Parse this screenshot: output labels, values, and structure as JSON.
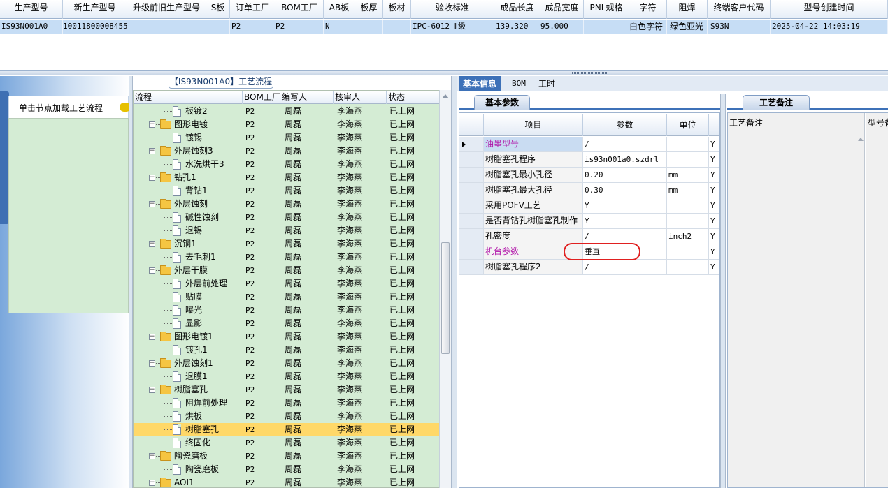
{
  "top_grid": {
    "headers": [
      {
        "label": "生产型号"
      },
      {
        "label": "新生产型号"
      },
      {
        "label": "升级前旧生产型号"
      },
      {
        "label": "S板"
      },
      {
        "label": "订单工厂"
      },
      {
        "label": "BOM工厂"
      },
      {
        "label": "AB板"
      },
      {
        "label": "板厚"
      },
      {
        "label": "板材"
      },
      {
        "label": "验收标准"
      },
      {
        "label": "成品长度"
      },
      {
        "label": "成品宽度"
      },
      {
        "label": "PNL规格"
      },
      {
        "label": "字符"
      },
      {
        "label": "阻焊"
      },
      {
        "label": "终端客户代码"
      },
      {
        "label": "型号创建时间"
      }
    ],
    "row": {
      "prod_model": "IS93N001A0",
      "new_model": "10011800008455",
      "old_model": "",
      "s_board": "",
      "order_factory": "P2",
      "bom_factory": "P2",
      "ab_board": "N",
      "thickness": "",
      "material": "",
      "standard": "IPC-6012 Ⅱ级",
      "length": "139.320",
      "width": "95.000",
      "pnl": "",
      "char": "白色字符",
      "solder": "绿色亚光",
      "client_code": "S93N",
      "created": "2025-04-22 14:03:19"
    }
  },
  "left": {
    "tab_label": "单击节点加载工艺流程"
  },
  "flow": {
    "caption": "【IS93N001A0】工艺流程",
    "headers": {
      "name": "流程",
      "bom": "BOM工厂",
      "writer": "编写人",
      "checker": "核审人",
      "status": "状态"
    },
    "rows": [
      {
        "name": "板镀2",
        "kind": "doc",
        "bom": "P2",
        "writer": "周磊",
        "checker": "李海燕",
        "status": "已上网"
      },
      {
        "name": "图形电镀",
        "kind": "folder",
        "bom": "P2",
        "writer": "周磊",
        "checker": "李海燕",
        "status": "已上网"
      },
      {
        "name": "镀锡",
        "kind": "doc",
        "bom": "P2",
        "writer": "周磊",
        "checker": "李海燕",
        "status": "已上网"
      },
      {
        "name": "外层蚀刻3",
        "kind": "folder",
        "bom": "P2",
        "writer": "周磊",
        "checker": "李海燕",
        "status": "已上网"
      },
      {
        "name": "水洗烘干3",
        "kind": "doc",
        "bom": "P2",
        "writer": "周磊",
        "checker": "李海燕",
        "status": "已上网"
      },
      {
        "name": "钻孔1",
        "kind": "folder",
        "bom": "P2",
        "writer": "周磊",
        "checker": "李海燕",
        "status": "已上网"
      },
      {
        "name": "背钻1",
        "kind": "doc",
        "bom": "P2",
        "writer": "周磊",
        "checker": "李海燕",
        "status": "已上网"
      },
      {
        "name": "外层蚀刻",
        "kind": "folder",
        "bom": "P2",
        "writer": "周磊",
        "checker": "李海燕",
        "status": "已上网"
      },
      {
        "name": "碱性蚀刻",
        "kind": "doc",
        "bom": "P2",
        "writer": "周磊",
        "checker": "李海燕",
        "status": "已上网"
      },
      {
        "name": "退锡",
        "kind": "doc",
        "bom": "P2",
        "writer": "周磊",
        "checker": "李海燕",
        "status": "已上网"
      },
      {
        "name": "沉铜1",
        "kind": "folder",
        "bom": "P2",
        "writer": "周磊",
        "checker": "李海燕",
        "status": "已上网"
      },
      {
        "name": "去毛刺1",
        "kind": "doc",
        "bom": "P2",
        "writer": "周磊",
        "checker": "李海燕",
        "status": "已上网"
      },
      {
        "name": "外层干膜",
        "kind": "folder",
        "bom": "P2",
        "writer": "周磊",
        "checker": "李海燕",
        "status": "已上网"
      },
      {
        "name": "外层前处理",
        "kind": "doc",
        "bom": "P2",
        "writer": "周磊",
        "checker": "李海燕",
        "status": "已上网"
      },
      {
        "name": "贴膜",
        "kind": "doc",
        "bom": "P2",
        "writer": "周磊",
        "checker": "李海燕",
        "status": "已上网"
      },
      {
        "name": "曝光",
        "kind": "doc",
        "bom": "P2",
        "writer": "周磊",
        "checker": "李海燕",
        "status": "已上网"
      },
      {
        "name": "显影",
        "kind": "doc",
        "bom": "P2",
        "writer": "周磊",
        "checker": "李海燕",
        "status": "已上网"
      },
      {
        "name": "图形电镀1",
        "kind": "folder",
        "bom": "P2",
        "writer": "周磊",
        "checker": "李海燕",
        "status": "已上网"
      },
      {
        "name": "镀孔1",
        "kind": "doc",
        "bom": "P2",
        "writer": "周磊",
        "checker": "李海燕",
        "status": "已上网"
      },
      {
        "name": "外层蚀刻1",
        "kind": "folder",
        "bom": "P2",
        "writer": "周磊",
        "checker": "李海燕",
        "status": "已上网"
      },
      {
        "name": "退膜1",
        "kind": "doc",
        "bom": "P2",
        "writer": "周磊",
        "checker": "李海燕",
        "status": "已上网"
      },
      {
        "name": "树脂塞孔",
        "kind": "folder",
        "bom": "P2",
        "writer": "周磊",
        "checker": "李海燕",
        "status": "已上网"
      },
      {
        "name": "阻焊前处理",
        "kind": "doc",
        "bom": "P2",
        "writer": "周磊",
        "checker": "李海燕",
        "status": "已上网"
      },
      {
        "name": "烘板",
        "kind": "doc",
        "bom": "P2",
        "writer": "周磊",
        "checker": "李海燕",
        "status": "已上网"
      },
      {
        "name": "树脂塞孔",
        "kind": "doc",
        "bom": "P2",
        "writer": "周磊",
        "checker": "李海燕",
        "status": "已上网",
        "selected": true
      },
      {
        "name": "终固化",
        "kind": "doc",
        "bom": "P2",
        "writer": "周磊",
        "checker": "李海燕",
        "status": "已上网"
      },
      {
        "name": "陶瓷磨板",
        "kind": "folder",
        "bom": "P2",
        "writer": "周磊",
        "checker": "李海燕",
        "status": "已上网"
      },
      {
        "name": "陶瓷磨板",
        "kind": "doc",
        "bom": "P2",
        "writer": "周磊",
        "checker": "李海燕",
        "status": "已上网"
      },
      {
        "name": "AOI1",
        "kind": "folder",
        "bom": "P2",
        "writer": "周磊",
        "checker": "李海燕",
        "status": "已上网"
      }
    ]
  },
  "right_tabs": [
    {
      "label": "基本信息",
      "active": true
    },
    {
      "label": "BOM",
      "active": false
    },
    {
      "label": "工时",
      "active": false
    }
  ],
  "params_panel": {
    "subtab": "基本参数",
    "headers": {
      "item": "项目",
      "param": "参数",
      "unit": "单位"
    },
    "rows": [
      {
        "item": "油墨型号",
        "param": "/",
        "unit": "",
        "flag": "Y",
        "highlight": true,
        "current": true
      },
      {
        "item": "树脂塞孔程序",
        "param": "is93n001a0.szdrl",
        "unit": "",
        "flag": "Y"
      },
      {
        "item": "树脂塞孔最小孔径",
        "param": "0.20",
        "unit": "mm",
        "flag": "Y"
      },
      {
        "item": "树脂塞孔最大孔径",
        "param": "0.30",
        "unit": "mm",
        "flag": "Y"
      },
      {
        "item": "采用POFV工艺",
        "param": "Y",
        "unit": "",
        "flag": "Y"
      },
      {
        "item": "是否背钻孔树脂塞孔制作",
        "param": "Y",
        "unit": "",
        "flag": "Y"
      },
      {
        "item": "孔密度",
        "param": "/",
        "unit": "inch2",
        "flag": "Y"
      },
      {
        "item": "机台参数",
        "param": "垂直",
        "unit": "",
        "flag": "Y",
        "highlight": true
      },
      {
        "item": "树脂塞孔程序2",
        "param": "/",
        "unit": "",
        "flag": "Y"
      }
    ]
  },
  "notes_panel": {
    "subtab": "工艺备注",
    "col_a": "工艺备注",
    "col_b": "型号备"
  }
}
